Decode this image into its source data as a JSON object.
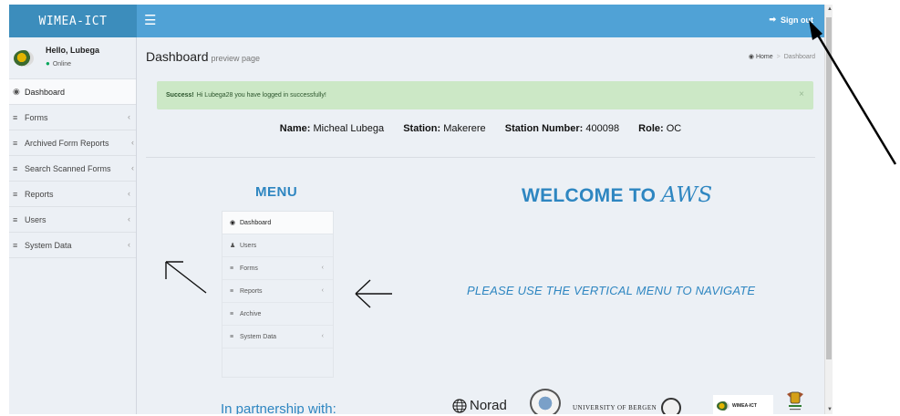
{
  "header": {
    "logo_text": "WIMEA-ICT",
    "menu_toggle_icon": "hamburger-icon",
    "signout_label": "Sign out"
  },
  "user": {
    "greeting": "Hello, Lubega",
    "status": "Online"
  },
  "sidebar": {
    "items": [
      {
        "label": "Dashboard",
        "icon": "dashboard-icon"
      },
      {
        "label": "Forms",
        "icon": "list-icon"
      },
      {
        "label": "Archived Form Reports",
        "icon": "list-icon"
      },
      {
        "label": "Search Scanned Forms",
        "icon": "list-icon"
      },
      {
        "label": "Reports",
        "icon": "list-icon"
      },
      {
        "label": "Users",
        "icon": "list-icon"
      },
      {
        "label": "System Data",
        "icon": "list-icon"
      }
    ]
  },
  "page": {
    "title": "Dashboard",
    "subtitle": "preview page",
    "breadcrumb": [
      "Home",
      "Dashboard"
    ]
  },
  "alert": {
    "strong": "Success!",
    "message": "Hi Lubega28 you have logged in successfully!",
    "close": "×"
  },
  "info": {
    "name_label": "Name:",
    "name_value": "Micheal Lubega",
    "station_label": "Station:",
    "station_value": "Makerere",
    "number_label": "Station Number:",
    "number_value": "400098",
    "role_label": "Role:",
    "role_value": "OC"
  },
  "preview_menu": {
    "title": "MENU",
    "items": [
      {
        "label": "Dashboard",
        "icon": "dashboard-icon"
      },
      {
        "label": "Users",
        "icon": "user-icon"
      },
      {
        "label": "Forms",
        "icon": "list-icon"
      },
      {
        "label": "Reports",
        "icon": "list-icon"
      },
      {
        "label": "Archive",
        "icon": "list-icon"
      },
      {
        "label": "System Data",
        "icon": "list-icon"
      }
    ]
  },
  "welcome": {
    "prefix": "WELCOME TO",
    "brand": "AWS",
    "instruction": "PLEASE USE THE VERTICAL MENU TO NAVIGATE"
  },
  "partners": {
    "heading": "In partnership with:",
    "norad": "Norad",
    "university": "UNIVERSITY OF BERGEN",
    "wimea": "WIMEA-ICT"
  },
  "colors": {
    "topbar": "#50a2d6",
    "logo_bg": "#3c8dbc",
    "accent_text": "#2e86c1",
    "success_bg": "#cce8c6",
    "online_dot": "#00a65a"
  }
}
